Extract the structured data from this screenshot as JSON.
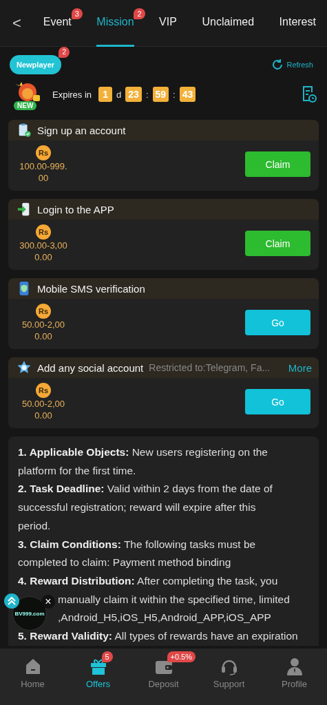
{
  "header": {
    "back": "<",
    "tabs": [
      {
        "label": "Event",
        "selected": false,
        "badge": "3"
      },
      {
        "label": "Mission",
        "selected": true,
        "badge": "2"
      },
      {
        "label": "VIP",
        "selected": false
      },
      {
        "label": "Unclaimed",
        "selected": false
      },
      {
        "label": "Interest",
        "selected": false
      }
    ]
  },
  "category": {
    "label": "Newplayer",
    "selected": true,
    "badge": "2"
  },
  "refresh": "Refresh",
  "expiry": {
    "new_tag": "NEW",
    "label": "Expires in",
    "days": "1",
    "days_unit": "d",
    "hours": "23",
    "minutes": "59",
    "seconds": "43",
    "separator": ":"
  },
  "tasks": [
    {
      "kind": "clipboard",
      "title": "Sign up an account",
      "currency": "Rs",
      "amount": "100.00-999.\n00",
      "button": {
        "label": "Claim",
        "kind": "claim"
      }
    },
    {
      "kind": "login",
      "title": "Login to the APP",
      "currency": "Rs",
      "amount": "300.00-3,00\n0.00",
      "button": {
        "label": "Claim",
        "kind": "claim"
      }
    },
    {
      "kind": "phone",
      "title": "Mobile SMS verification",
      "currency": "Rs",
      "amount": "50.00-2,00\n0.00",
      "button": {
        "label": "Go",
        "kind": "go"
      }
    },
    {
      "kind": "social",
      "title": "Add any social account",
      "note": "Restricted to:Telegram, Fa...",
      "more": "More",
      "currency": "Rs",
      "amount": "50.00-2,00\n0.00",
      "button": {
        "label": "Go",
        "kind": "go"
      }
    }
  ],
  "rules": [
    {
      "heading": "1. Applicable Objects:",
      "text": "New users registering on the platform for the first time."
    },
    {
      "heading": "2. Task Deadline:",
      "text": "Valid within 2 days from the date of successful registration; reward will expire after this period."
    },
    {
      "heading": "3. Claim Conditions:",
      "text": "The following tasks must be completed to claim: Payment method binding"
    },
    {
      "heading": "4. Reward Distribution:",
      "text": "After completing the task, you",
      "continued": [
        "manually claim it within the specified time, limited",
        ",Android_H5,iOS_H5,Android_APP,iOS_APP"
      ]
    },
    {
      "heading": "5. Reward Validity:",
      "text": "All types of rewards have an expiration"
    }
  ],
  "floating": {
    "logo": "BV999.com",
    "close": "×"
  },
  "nav": [
    {
      "label": "Home",
      "kind": "home",
      "selected": false
    },
    {
      "label": "Offers",
      "kind": "gift",
      "selected": true,
      "badge": "5"
    },
    {
      "label": "Deposit",
      "kind": "wallet",
      "selected": false,
      "badge": "+0.5%"
    },
    {
      "label": "Support",
      "kind": "headset",
      "selected": false
    },
    {
      "label": "Profile",
      "kind": "person",
      "selected": false
    }
  ]
}
